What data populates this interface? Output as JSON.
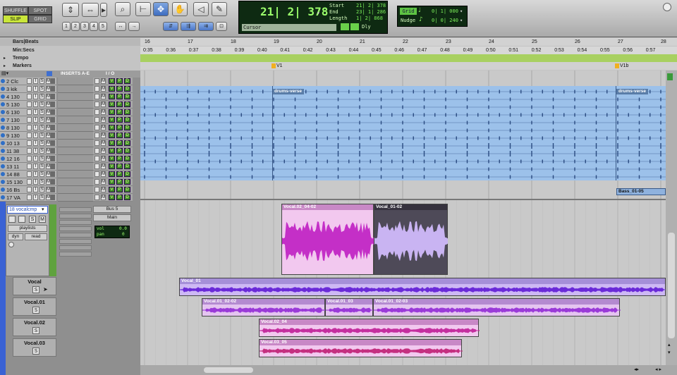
{
  "toolbar": {
    "modes": {
      "shuffle": "SHUFFLE",
      "spot": "SPOT",
      "slip": "SLIP",
      "grid": "GRID"
    },
    "zoom_presets": [
      "1",
      "2",
      "3",
      "4",
      "5"
    ],
    "counter": {
      "main": "21| 2| 378",
      "start_label": "Start",
      "end_label": "End",
      "length_label": "Length",
      "start": "21| 2| 378",
      "end": "23| 1| 286",
      "length": "1| 2| 868",
      "cursor_label": "Cursor",
      "dly_label": "Dly"
    },
    "grid": {
      "label": "Grid",
      "value": "0| 1| 000"
    },
    "nudge": {
      "label": "Nudge",
      "value": "0| 0| 240"
    }
  },
  "rulers": {
    "labels": [
      "Bars|Beats",
      "Min:Secs",
      "Tempo",
      "Markers"
    ],
    "bars": [
      "16",
      "17",
      "18",
      "19",
      "20",
      "21",
      "22",
      "23",
      "24",
      "25",
      "26",
      "27",
      "28"
    ],
    "secs": [
      "0:35",
      "0:36",
      "0:37",
      "0:38",
      "0:39",
      "0:40",
      "0:41",
      "0:42",
      "0:43",
      "0:44",
      "0:45",
      "0:46",
      "0:47",
      "0:48",
      "0:49",
      "0:50",
      "0:51",
      "0:52",
      "0:53",
      "0:54",
      "0:55",
      "0:56",
      "0:57"
    ],
    "markers": [
      "V1",
      "V1b"
    ]
  },
  "columns": {
    "inserts": "INSERTS A-E",
    "io": "I / O"
  },
  "tracks": [
    "2 Clc",
    "3 kik",
    "4 130",
    "5 130",
    "6 130",
    "7 130",
    "8 130",
    "9 130",
    "10 13",
    "11 38",
    "12 16",
    "13 11",
    "14 88",
    "15 130",
    "16 Bs",
    "17 VA"
  ],
  "vocal_track": {
    "name": "18 vocalcmp",
    "playlists_label": "playlists",
    "dyn_label": "dyn",
    "read_label": "read",
    "bus": "Bus 5",
    "main": "Main",
    "vol_label": "vol",
    "vol_value": "0.0",
    "pan_label": "pan",
    "pan_value": "0"
  },
  "playlists": [
    "Vocal",
    "Vocal.01",
    "Vocal.02",
    "Vocal.03"
  ],
  "clips": {
    "drums1": "drums-verse",
    "drums2": "drums-verse",
    "bass": "Bass_01-05",
    "comp1": "Vocal.02_04-02",
    "comp2": "Vocal_01-02",
    "pl1": "Vocal_01",
    "pl2a": "Vocal.01_02-02",
    "pl2b": "Vocal.01_03",
    "pl2c": "Vocal.01_02-03",
    "pl3": "Vocal.02_04",
    "pl4": "Vocal.03_05"
  },
  "colors": {
    "drums": "#8fb8e8",
    "comp_pink": "#f0c4ee",
    "comp_dark": "#4a4455",
    "vocal_purple": "#cdb6f4",
    "wave_pink": "#c42fc7",
    "wave_purple": "#7a2fd8"
  }
}
